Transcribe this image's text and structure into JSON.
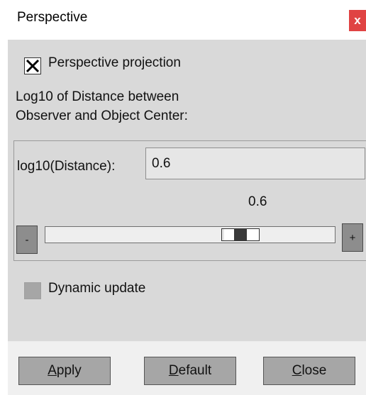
{
  "window": {
    "title": "Perspective",
    "close_glyph": "x"
  },
  "projection": {
    "checkbox_checked": true,
    "label": "Perspective projection"
  },
  "info": {
    "line1": "Log10 of Distance between",
    "line2": "Observer and Object Center:"
  },
  "distance": {
    "label": "log10(Distance):",
    "value": "0.6",
    "slider_value_text": "0.6",
    "slider_position_fraction": 0.7,
    "minus_label": "-",
    "plus_label": "+"
  },
  "dynamic": {
    "checkbox_checked": false,
    "label": "Dynamic update"
  },
  "buttons": {
    "apply": {
      "mnemonic": "A",
      "rest": "pply"
    },
    "default": {
      "mnemonic": "D",
      "rest": "efault"
    },
    "close": {
      "mnemonic": "C",
      "rest": "lose"
    }
  },
  "colors": {
    "close_button": "#e04343",
    "panel": "#d9d9d9",
    "footer": "#f0f0f0"
  }
}
